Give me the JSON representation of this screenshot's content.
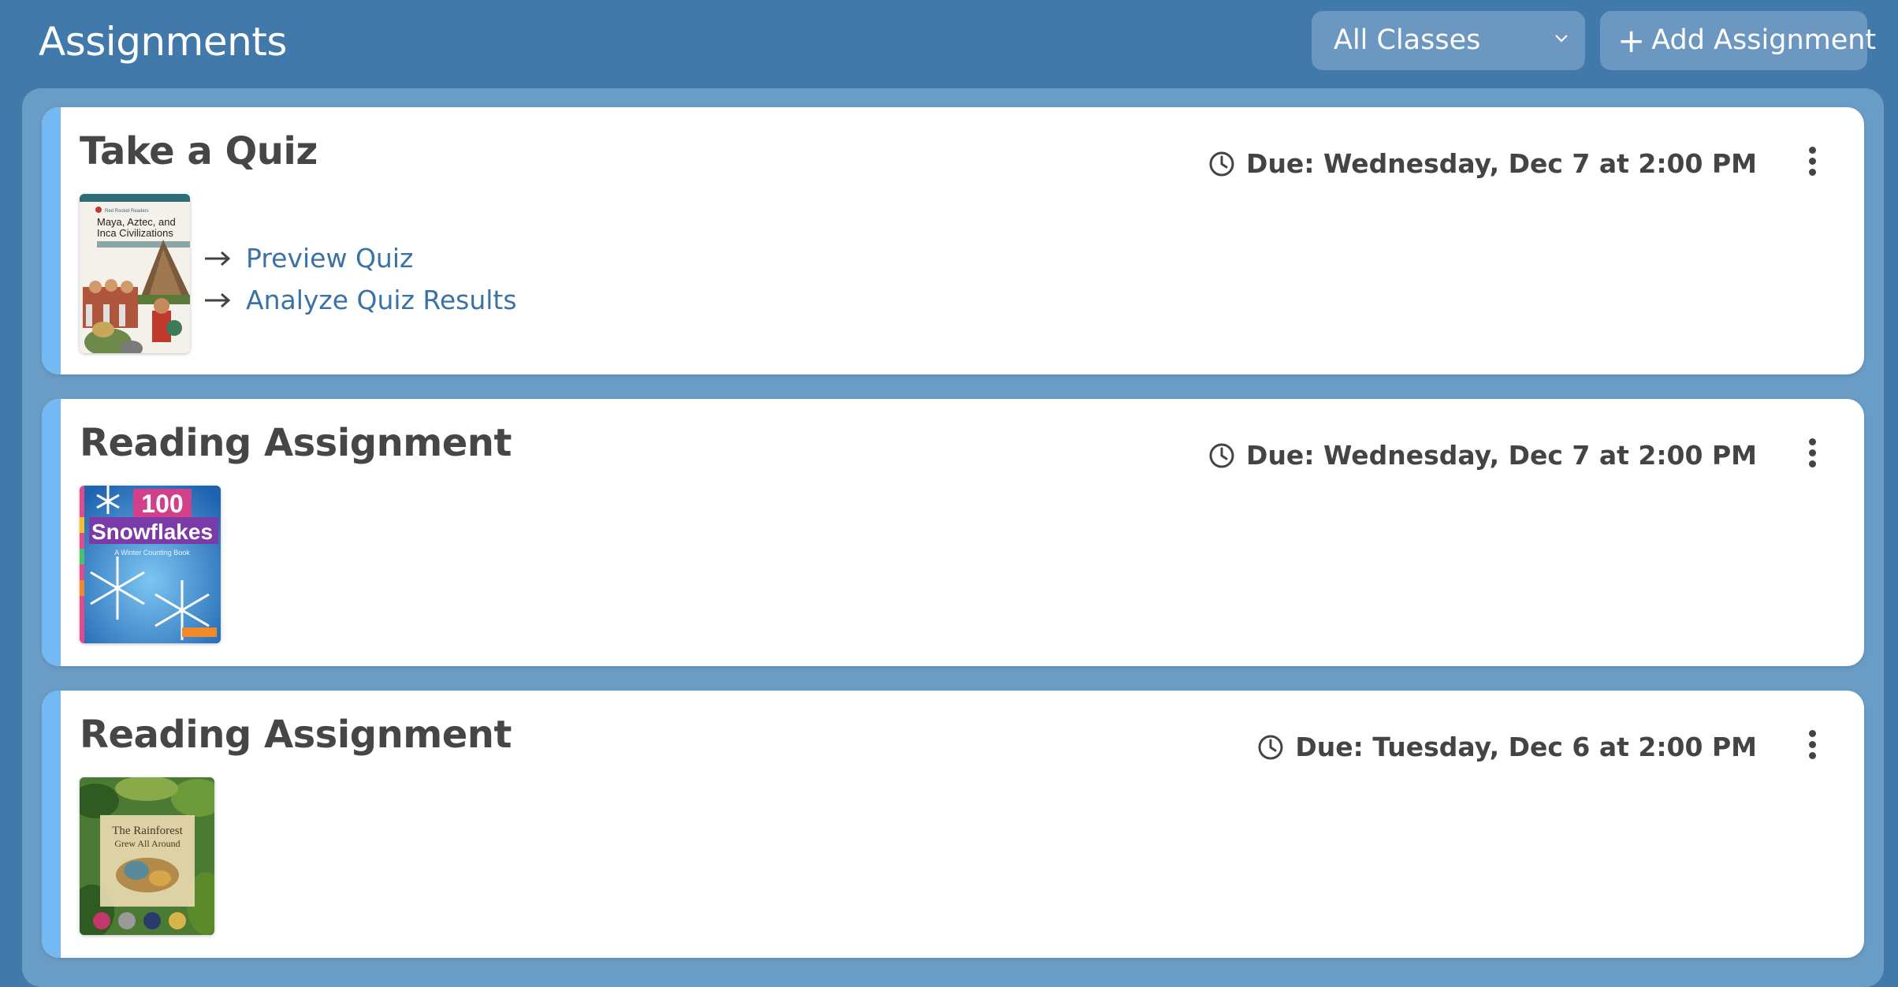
{
  "header": {
    "title": "Assignments",
    "class_filter": "All Classes",
    "add_button": "Add Assignment"
  },
  "assignments": [
    {
      "title": "Take a Quiz",
      "due": "Due: Wednesday, Dec 7 at 2:00 PM",
      "cover": {
        "series": "Red Rocket Readers",
        "title_line1": "Maya, Aztec, and",
        "title_line2": "Inca Civilizations"
      },
      "links": [
        "Preview Quiz",
        "Analyze Quiz Results"
      ]
    },
    {
      "title": "Reading Assignment",
      "due": "Due: Wednesday, Dec 7 at 2:00 PM",
      "cover": {
        "title_number": "100",
        "title_word": "Snowflakes",
        "subtitle": "A Winter Counting Book"
      }
    },
    {
      "title": "Reading Assignment",
      "due": "Due: Tuesday, Dec 6 at 2:00 PM",
      "cover": {
        "title_line1": "The Rainforest",
        "title_line2": "Grew All Around"
      }
    }
  ],
  "colors": {
    "background": "#4079aa",
    "panel": "#6a9dc6",
    "accent": "#74b8f4",
    "link": "#3a72a6"
  }
}
